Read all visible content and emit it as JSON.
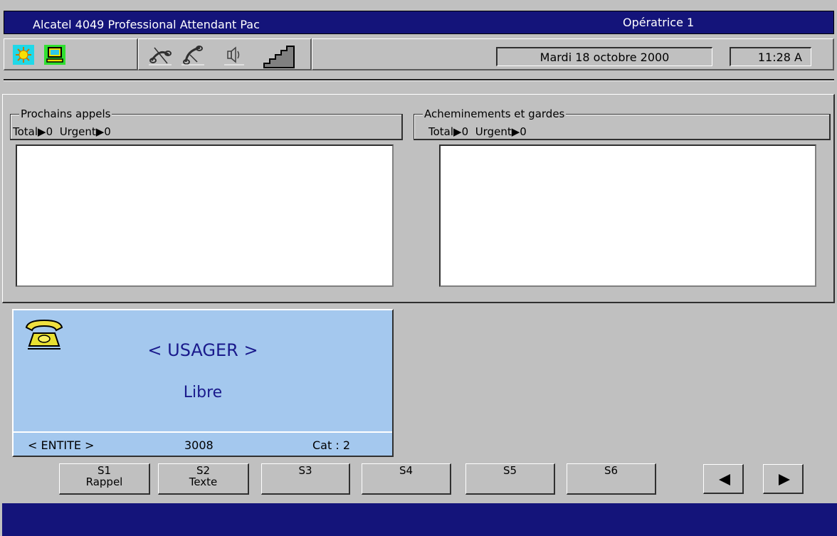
{
  "window": {
    "app_title": "Alcatel 4049 Professional Attendant Pac",
    "operator": "Opératrice 1"
  },
  "toolbar": {
    "icons": [
      "sun-icon",
      "monitor-icon",
      "handset-crossed-icon",
      "handset-icon",
      "speaker-icon",
      "volume-stairs-icon"
    ],
    "date": "Mardi 18 octobre 2000",
    "time": "11:28 A"
  },
  "next_calls": {
    "title": "Prochains appels",
    "total_label": "Total",
    "total_value": "0",
    "urgent_label": "Urgent",
    "urgent_value": "0"
  },
  "routing": {
    "title": "Acheminements et gardes",
    "total_label": "Total",
    "total_value": "0",
    "urgent_label": "Urgent",
    "urgent_value": "0"
  },
  "user_panel": {
    "name": "< USAGER >",
    "state": "Libre",
    "entity": "< ENTITE >",
    "number": "3008",
    "category": "Cat : 2"
  },
  "softkeys": [
    {
      "key": "S1",
      "label": "Rappel"
    },
    {
      "key": "S2",
      "label": "Texte"
    },
    {
      "key": "S3",
      "label": ""
    },
    {
      "key": "S4",
      "label": ""
    },
    {
      "key": "S5",
      "label": ""
    },
    {
      "key": "S6",
      "label": ""
    }
  ],
  "colors": {
    "titlebar": "#14147a",
    "panel": "#c0c0c0",
    "user_panel": "#a4c8ee",
    "user_text": "#1a1a8c"
  }
}
